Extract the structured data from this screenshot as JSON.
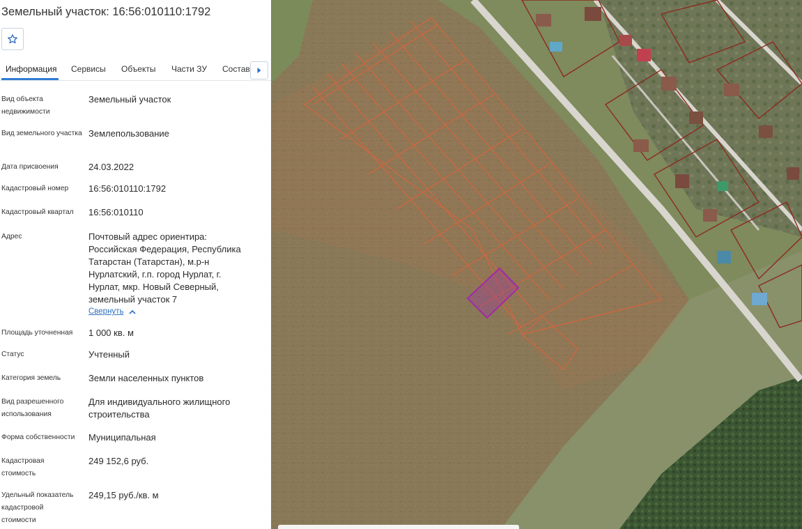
{
  "header": {
    "title": "Земельный участок: 16:56:010110:1792"
  },
  "favorite": {
    "icon": "star-outline-icon"
  },
  "tabs": [
    {
      "label": "Информация",
      "active": true
    },
    {
      "label": "Сервисы",
      "active": false
    },
    {
      "label": "Объекты",
      "active": false
    },
    {
      "label": "Части ЗУ",
      "active": false
    },
    {
      "label": "Состав",
      "active": false
    }
  ],
  "tabs_next_icon": "chevron-right-icon",
  "info": {
    "object_type": {
      "label": "Вид объекта недвижимости",
      "value": "Земельный участок"
    },
    "land_type": {
      "label": "Вид земельного участка",
      "value": "Землепользование"
    },
    "assigned_date": {
      "label": "Дата присвоения",
      "value": "24.03.2022"
    },
    "cadastral_number": {
      "label": "Кадастровый номер",
      "value": "16:56:010110:1792"
    },
    "cadastral_quarter": {
      "label": "Кадастровый квартал",
      "value": "16:56:010110"
    },
    "address": {
      "label": "Адрес",
      "value": "Почтовый адрес ориентира: Российская Федерация, Республика Татарстан (Татарстан), м.р-н Нурлатский, г.п. город Нурлат, г. Нурлат, мкр. Новый Северный, земельный участок 7",
      "collapse_label": "Свернуть"
    },
    "area": {
      "label": "Площадь уточненная",
      "value": "1 000 кв. м"
    },
    "status": {
      "label": "Статус",
      "value": "Учтенный"
    },
    "land_category": {
      "label": "Категория земель",
      "value": "Земли населенных пунктов"
    },
    "permitted_use": {
      "label": "Вид разрешенного использования",
      "value": "Для индивидуального жилищного строительства"
    },
    "ownership": {
      "label": "Форма собственности",
      "value": "Муниципальная"
    },
    "cadastral_value": {
      "label": "Кадастровая стоимость",
      "value": "249 152,6 руб."
    },
    "specific_value": {
      "label": "Удельный показатель кадастровой стоимости",
      "value": "249,15 руб./кв. м"
    }
  },
  "map": {
    "colors": {
      "field": "#8a7a57",
      "grass": "#7e8b5c",
      "forest": "#3f5a34",
      "road": "#d9d6cf",
      "parcel_lines": "#e0623a",
      "house_parcels": "#8c2a1e",
      "selected_parcel": "#a22aa8"
    }
  }
}
